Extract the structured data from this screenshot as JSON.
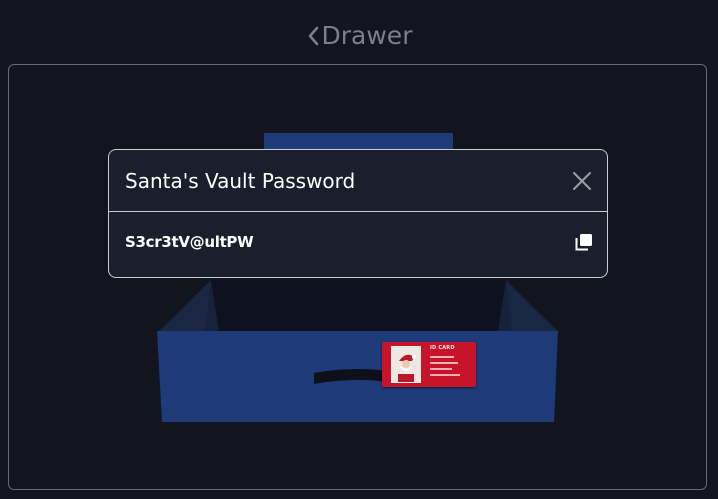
{
  "header": {
    "back_label": "Drawer",
    "back_icon": "chevron-left-icon",
    "color": "#7b7f87"
  },
  "scene": {
    "drawer_color": "#1f3a78",
    "card": {
      "title": "ID CARD",
      "color": "#c8142a"
    }
  },
  "modal": {
    "title": "Santa's Vault Password",
    "password": "S3cr3tV@ultPW",
    "close_icon": "close-icon",
    "copy_icon": "copy-icon",
    "background": "#1a1f2e",
    "border": "#c9ccd3"
  },
  "colors": {
    "page_background": "#12151d",
    "panel_border": "#666a73"
  }
}
